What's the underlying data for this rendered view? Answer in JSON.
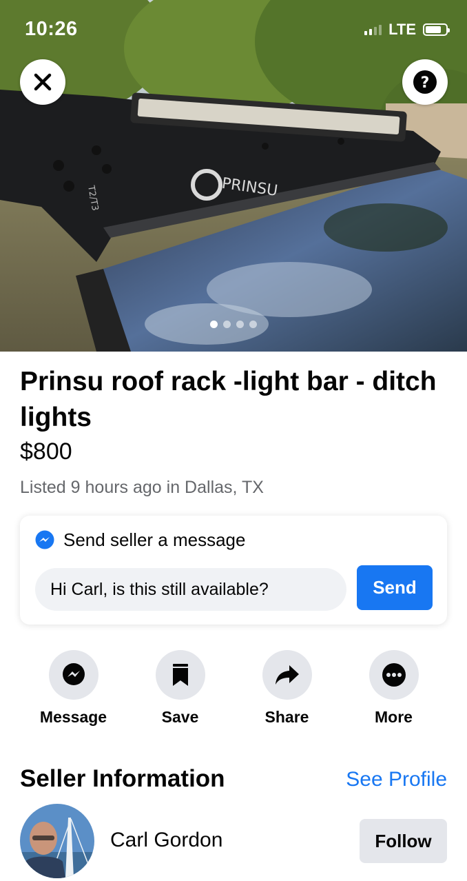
{
  "status_bar": {
    "time": "10:26",
    "network": "LTE",
    "battery_level": 0.8
  },
  "hero": {
    "image_count": 4,
    "active_image": 1,
    "brand_on_rack": "PRINSU",
    "rack_marking": "T2/T3"
  },
  "listing": {
    "title": "Prinsu roof rack -light bar - ditch lights",
    "price": "$800",
    "listed": "Listed 9 hours ago in Dallas, TX"
  },
  "message_card": {
    "heading": "Send seller a message",
    "input_value": "Hi Carl, is this still available?",
    "send_label": "Send"
  },
  "actions": [
    {
      "label": "Message",
      "icon": "messenger-icon"
    },
    {
      "label": "Save",
      "icon": "bookmark-icon"
    },
    {
      "label": "Share",
      "icon": "share-icon"
    },
    {
      "label": "More",
      "icon": "more-icon"
    }
  ],
  "seller": {
    "heading": "Seller Information",
    "see_profile": "See Profile",
    "name": "Carl Gordon",
    "follow_label": "Follow"
  },
  "colors": {
    "accent": "#1877f2",
    "secondary_text": "#65676b",
    "button_gray": "#e4e6eb",
    "input_gray": "#f0f2f5"
  }
}
